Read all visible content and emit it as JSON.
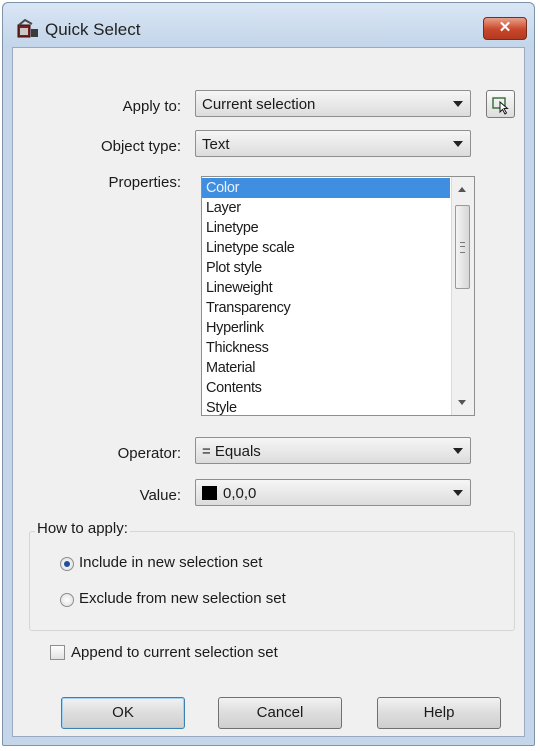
{
  "window": {
    "title": "Quick Select",
    "close_label": "✕"
  },
  "apply_to": {
    "label": "Apply to:",
    "value": "Current selection"
  },
  "object_type": {
    "label": "Object type:",
    "value": "Text"
  },
  "properties": {
    "label": "Properties:",
    "items": [
      "Color",
      "Layer",
      "Linetype",
      "Linetype scale",
      "Plot style",
      "Lineweight",
      "Transparency",
      "Hyperlink",
      "Thickness",
      "Material",
      "Contents",
      "Style"
    ],
    "selected": "Color"
  },
  "operator": {
    "label": "Operator:",
    "value": "= Equals"
  },
  "value": {
    "label": "Value:",
    "value": "0,0,0",
    "swatch_color": "#000000"
  },
  "how_to_apply": {
    "title": "How to apply:",
    "include_label": "Include in new selection set",
    "exclude_label": "Exclude from new selection set",
    "selected": "include"
  },
  "append": {
    "label": "Append to current selection set",
    "checked": false
  },
  "buttons": {
    "ok": "OK",
    "cancel": "Cancel",
    "help": "Help"
  }
}
